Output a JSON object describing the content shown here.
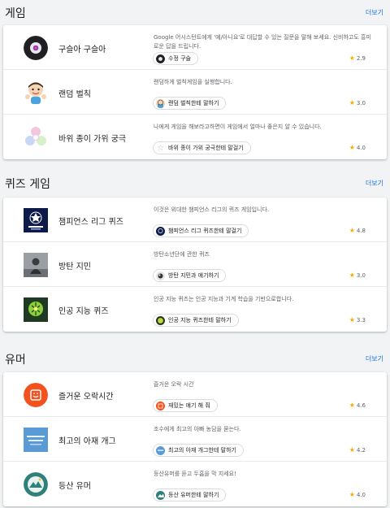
{
  "more_label": "더보기",
  "sections": [
    {
      "title": "게임",
      "items": [
        {
          "name": "구슬아 구슬아",
          "description": "Google 어시스턴트에게 '예/아니요'로 대답할 수 있는 질문을 말해 보세요. 신비하고도 흥미로운 답을 드립니다.",
          "action": "수정 구슬",
          "rating": "2.9",
          "icon": "crystal-ball-icon"
        },
        {
          "name": "랜덤 벌칙",
          "description": "랜덤하게 벌칙게임을 실행합니다.",
          "action": "랜덤 벌칙한테 말하기",
          "rating": "3.0",
          "icon": "penalty-character-icon"
        },
        {
          "name": "바위 종이 가위 궁극",
          "description": "나에게 게임을 해보라고하면이 게임에서 얼마나 좋은지 알 수 있습니다.",
          "action": "바위 종이 가위 궁극한테 말걸기",
          "rating": "4.0",
          "icon": "rock-paper-scissors-icon"
        }
      ]
    },
    {
      "title": "퀴즈 게임",
      "items": [
        {
          "name": "챔피언스 리그 퀴즈",
          "description": "이것은 위대한 챔피언스 리그의 퀴즈 게임입니다.",
          "action": "챔피언스 리그 퀴즈한테 말걸기",
          "rating": "4.8",
          "icon": "champions-league-icon"
        },
        {
          "name": "방탄 지민",
          "description": "방탄소년단에 관한 퀴즈",
          "action": "방탄 지민과 얘기하기",
          "rating": "3.0",
          "icon": "photo-icon"
        },
        {
          "name": "인공 지능 퀴즈",
          "description": "인공 지능 퀴즈는 인공 지능과 기계 학습을 기반으로합니다.",
          "action": "인공 지능 퀴즈한테 말하기",
          "rating": "3.3",
          "icon": "ai-brain-icon"
        }
      ]
    },
    {
      "title": "유머",
      "items": [
        {
          "name": "즐거운 오락시간",
          "description": "즐거운 오락 시간",
          "action": "재밌는 얘기 해 줘",
          "rating": "4.6",
          "icon": "smile-note-icon"
        },
        {
          "name": "최고의 아재 개그",
          "description": "조수에게 최고의 아빠 농담을 묻는다.",
          "action": "최고의 아재 개그한테 말하기",
          "rating": "4.2",
          "icon": "dad-joke-icon"
        },
        {
          "name": "등산 유머",
          "description": "등산유머를 듣고 두홉을 막 지세요!",
          "action": "등산 유머한테 말하기",
          "rating": "4.0",
          "icon": "mountain-globe-icon"
        }
      ]
    }
  ]
}
